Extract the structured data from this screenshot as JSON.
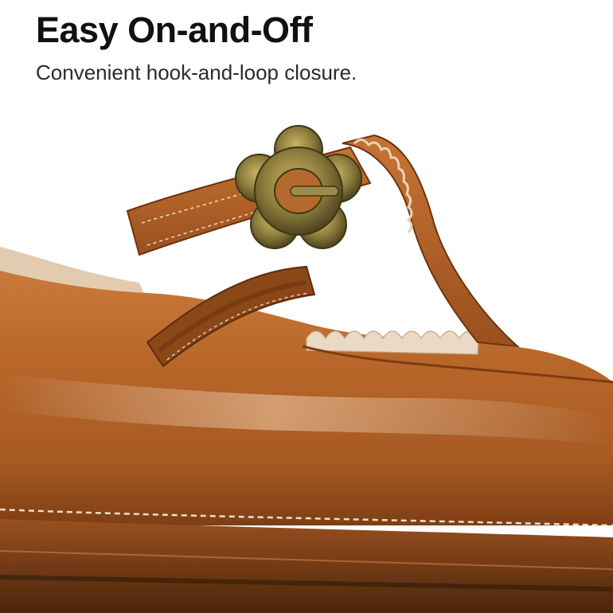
{
  "header": {
    "title": "Easy On-and-Off",
    "subtitle": "Convenient hook-and-loop closure."
  },
  "photo": {
    "subject": "shoe-product-photo",
    "palette": {
      "leather": "#b8672a",
      "leather_dark": "#8a4416",
      "leather_light": "#d78a4a",
      "stitch": "#f3dcc1",
      "lining": "#e4d3be",
      "buckle": "#8a7a3a",
      "sole": "#5a3012"
    }
  }
}
